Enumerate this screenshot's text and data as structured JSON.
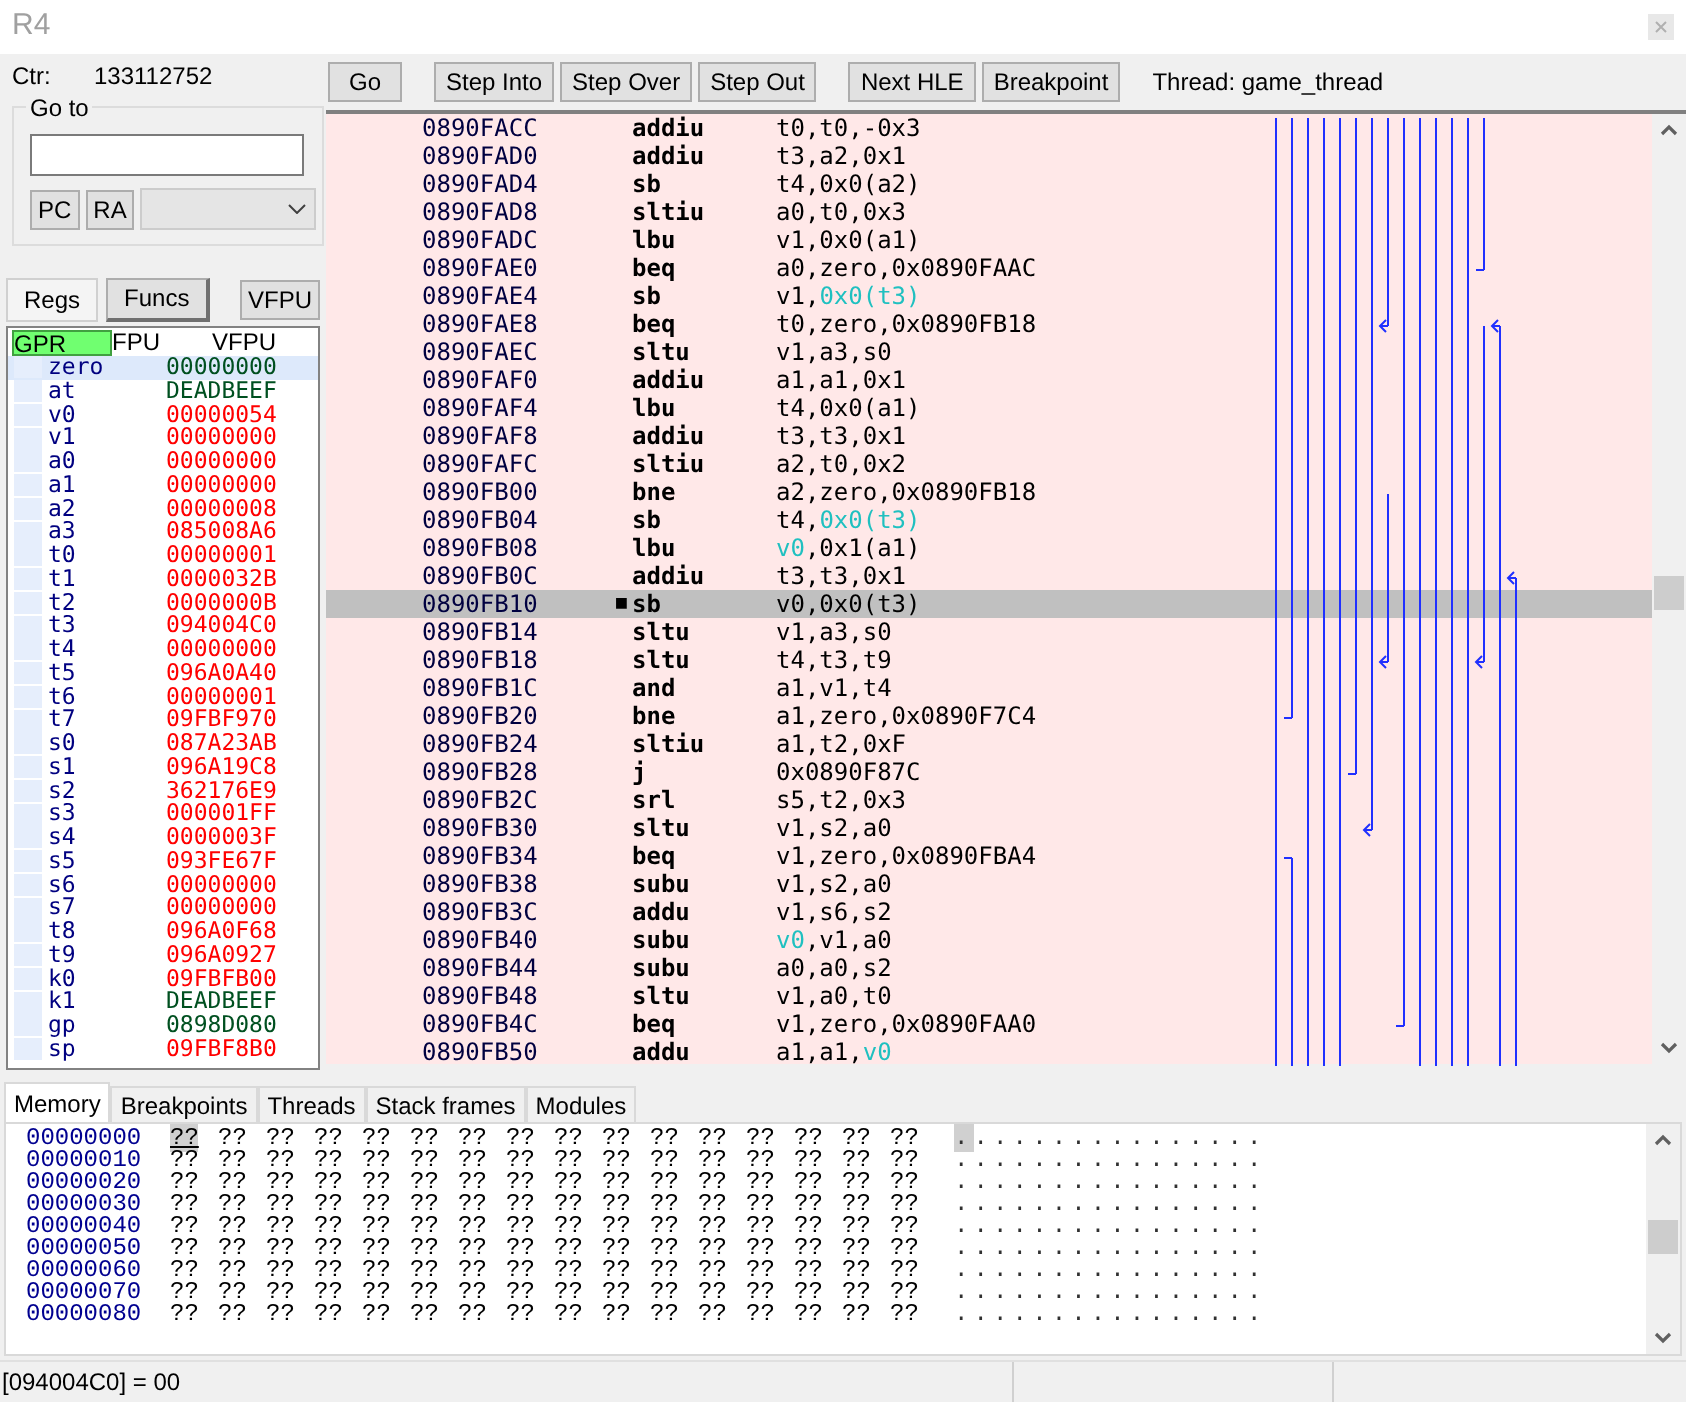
{
  "window": {
    "title": "R4"
  },
  "counter": {
    "label": "Ctr:",
    "value": "133112752"
  },
  "goto": {
    "label": "Go to",
    "buttons": [
      "PC",
      "RA"
    ]
  },
  "left_tabs": [
    {
      "label": "Regs",
      "selected": true
    },
    {
      "label": "Funcs",
      "selected": false
    }
  ],
  "vfpu_button": "VFPU",
  "register_tabs": [
    {
      "label": "GPR",
      "selected": true
    },
    {
      "label": "FPU",
      "selected": false
    },
    {
      "label": "VFPU",
      "selected": false
    }
  ],
  "registers": [
    {
      "name": "zero",
      "value": "00000000",
      "changed": false,
      "selected": true
    },
    {
      "name": "at",
      "value": "DEADBEEF",
      "changed": false,
      "selected": false
    },
    {
      "name": "v0",
      "value": "00000054",
      "changed": true,
      "selected": false
    },
    {
      "name": "v1",
      "value": "00000000",
      "changed": true,
      "selected": false
    },
    {
      "name": "a0",
      "value": "00000000",
      "changed": true,
      "selected": false
    },
    {
      "name": "a1",
      "value": "00000000",
      "changed": true,
      "selected": false
    },
    {
      "name": "a2",
      "value": "00000008",
      "changed": true,
      "selected": false
    },
    {
      "name": "a3",
      "value": "085008A6",
      "changed": true,
      "selected": false
    },
    {
      "name": "t0",
      "value": "00000001",
      "changed": true,
      "selected": false
    },
    {
      "name": "t1",
      "value": "0000032B",
      "changed": true,
      "selected": false
    },
    {
      "name": "t2",
      "value": "0000000B",
      "changed": true,
      "selected": false
    },
    {
      "name": "t3",
      "value": "094004C0",
      "changed": true,
      "selected": false
    },
    {
      "name": "t4",
      "value": "00000000",
      "changed": true,
      "selected": false
    },
    {
      "name": "t5",
      "value": "096A0A40",
      "changed": true,
      "selected": false
    },
    {
      "name": "t6",
      "value": "00000001",
      "changed": true,
      "selected": false
    },
    {
      "name": "t7",
      "value": "09FBF970",
      "changed": true,
      "selected": false
    },
    {
      "name": "s0",
      "value": "087A23AB",
      "changed": true,
      "selected": false
    },
    {
      "name": "s1",
      "value": "096A19C8",
      "changed": true,
      "selected": false
    },
    {
      "name": "s2",
      "value": "362176E9",
      "changed": true,
      "selected": false
    },
    {
      "name": "s3",
      "value": "000001FF",
      "changed": true,
      "selected": false
    },
    {
      "name": "s4",
      "value": "0000003F",
      "changed": true,
      "selected": false
    },
    {
      "name": "s5",
      "value": "093FE67F",
      "changed": true,
      "selected": false
    },
    {
      "name": "s6",
      "value": "00000000",
      "changed": true,
      "selected": false
    },
    {
      "name": "s7",
      "value": "00000000",
      "changed": true,
      "selected": false
    },
    {
      "name": "t8",
      "value": "096A0F68",
      "changed": true,
      "selected": false
    },
    {
      "name": "t9",
      "value": "096A0927",
      "changed": true,
      "selected": false
    },
    {
      "name": "k0",
      "value": "09FBFB00",
      "changed": true,
      "selected": false
    },
    {
      "name": "k1",
      "value": "DEADBEEF",
      "changed": false,
      "selected": false
    },
    {
      "name": "gp",
      "value": "0898D080",
      "changed": false,
      "selected": false
    },
    {
      "name": "sp",
      "value": "09FBF8B0",
      "changed": true,
      "selected": false
    }
  ],
  "toolbar": [
    [
      "Go"
    ],
    [
      "Step Into",
      "Step Over",
      "Step Out"
    ],
    [
      "Next HLE",
      "Breakpoint"
    ]
  ],
  "thread_label": "Thread: game_thread",
  "disassembly": [
    {
      "address": "0890FACC",
      "opcode": "addiu",
      "selected": false,
      "operands": [
        {
          "text": "t0,t0,-0x3",
          "highlighted": false
        }
      ]
    },
    {
      "address": "0890FAD0",
      "opcode": "addiu",
      "selected": false,
      "operands": [
        {
          "text": "t3,a2,0x1",
          "highlighted": false
        }
      ]
    },
    {
      "address": "0890FAD4",
      "opcode": "sb",
      "selected": false,
      "operands": [
        {
          "text": "t4,0x0(a2)",
          "highlighted": false
        }
      ]
    },
    {
      "address": "0890FAD8",
      "opcode": "sltiu",
      "selected": false,
      "operands": [
        {
          "text": "a0,t0,0x3",
          "highlighted": false
        }
      ]
    },
    {
      "address": "0890FADC",
      "opcode": "lbu",
      "selected": false,
      "operands": [
        {
          "text": "v1,0x0(a1)",
          "highlighted": false
        }
      ]
    },
    {
      "address": "0890FAE0",
      "opcode": "beq",
      "selected": false,
      "operands": [
        {
          "text": "a0,zero,0x0890FAAC",
          "highlighted": false
        }
      ]
    },
    {
      "address": "0890FAE4",
      "opcode": "sb",
      "selected": false,
      "operands": [
        {
          "text": "v1,",
          "highlighted": false
        },
        {
          "text": "0x0(t3)",
          "highlighted": true
        }
      ]
    },
    {
      "address": "0890FAE8",
      "opcode": "beq",
      "selected": false,
      "operands": [
        {
          "text": "t0,zero,0x0890FB18",
          "highlighted": false
        }
      ]
    },
    {
      "address": "0890FAEC",
      "opcode": "sltu",
      "selected": false,
      "operands": [
        {
          "text": "v1,a3,s0",
          "highlighted": false
        }
      ]
    },
    {
      "address": "0890FAF0",
      "opcode": "addiu",
      "selected": false,
      "operands": [
        {
          "text": "a1,a1,0x1",
          "highlighted": false
        }
      ]
    },
    {
      "address": "0890FAF4",
      "opcode": "lbu",
      "selected": false,
      "operands": [
        {
          "text": "t4,0x0(a1)",
          "highlighted": false
        }
      ]
    },
    {
      "address": "0890FAF8",
      "opcode": "addiu",
      "selected": false,
      "operands": [
        {
          "text": "t3,t3,0x1",
          "highlighted": false
        }
      ]
    },
    {
      "address": "0890FAFC",
      "opcode": "sltiu",
      "selected": false,
      "operands": [
        {
          "text": "a2,t0,0x2",
          "highlighted": false
        }
      ]
    },
    {
      "address": "0890FB00",
      "opcode": "bne",
      "selected": false,
      "operands": [
        {
          "text": "a2,zero,0x0890FB18",
          "highlighted": false
        }
      ]
    },
    {
      "address": "0890FB04",
      "opcode": "sb",
      "selected": false,
      "operands": [
        {
          "text": "t4,",
          "highlighted": false
        },
        {
          "text": "0x0(t3)",
          "highlighted": true
        }
      ]
    },
    {
      "address": "0890FB08",
      "opcode": "lbu",
      "selected": false,
      "operands": [
        {
          "text": "v0",
          "highlighted": true
        },
        {
          "text": ",0x1(a1)",
          "highlighted": false
        }
      ]
    },
    {
      "address": "0890FB0C",
      "opcode": "addiu",
      "selected": false,
      "operands": [
        {
          "text": "t3,t3,0x1",
          "highlighted": false
        }
      ]
    },
    {
      "address": "0890FB10",
      "marker": "■",
      "opcode": "sb",
      "selected": true,
      "operands": [
        {
          "text": "v0,0x0(t3)",
          "highlighted": false
        }
      ]
    },
    {
      "address": "0890FB14",
      "opcode": "sltu",
      "selected": false,
      "operands": [
        {
          "text": "v1,a3,s0",
          "highlighted": false
        }
      ]
    },
    {
      "address": "0890FB18",
      "opcode": "sltu",
      "selected": false,
      "operands": [
        {
          "text": "t4,t3,t9",
          "highlighted": false
        }
      ]
    },
    {
      "address": "0890FB1C",
      "opcode": "and",
      "selected": false,
      "operands": [
        {
          "text": "a1,v1,t4",
          "highlighted": false
        }
      ]
    },
    {
      "address": "0890FB20",
      "opcode": "bne",
      "selected": false,
      "operands": [
        {
          "text": "a1,zero,0x0890F7C4",
          "highlighted": false
        }
      ]
    },
    {
      "address": "0890FB24",
      "opcode": "sltiu",
      "selected": false,
      "operands": [
        {
          "text": "a1,t2,0xF",
          "highlighted": false
        }
      ]
    },
    {
      "address": "0890FB28",
      "opcode": "j",
      "selected": false,
      "operands": [
        {
          "text": "0x0890F87C",
          "highlighted": false
        }
      ]
    },
    {
      "address": "0890FB2C",
      "opcode": "srl",
      "selected": false,
      "operands": [
        {
          "text": "s5,t2,0x3",
          "highlighted": false
        }
      ]
    },
    {
      "address": "0890FB30",
      "opcode": "sltu",
      "selected": false,
      "operands": [
        {
          "text": "v1,s2,a0",
          "highlighted": false
        }
      ]
    },
    {
      "address": "0890FB34",
      "opcode": "beq",
      "selected": false,
      "operands": [
        {
          "text": "v1,zero,0x0890FBA4",
          "highlighted": false
        }
      ]
    },
    {
      "address": "0890FB38",
      "opcode": "subu",
      "selected": false,
      "operands": [
        {
          "text": "v1,s2,a0",
          "highlighted": false
        }
      ]
    },
    {
      "address": "0890FB3C",
      "opcode": "addu",
      "selected": false,
      "operands": [
        {
          "text": "v1,s6,s2",
          "highlighted": false
        }
      ]
    },
    {
      "address": "0890FB40",
      "opcode": "subu",
      "selected": false,
      "operands": [
        {
          "text": "v0",
          "highlighted": true
        },
        {
          "text": ",v1,a0",
          "highlighted": false
        }
      ]
    },
    {
      "address": "0890FB44",
      "opcode": "subu",
      "selected": false,
      "operands": [
        {
          "text": "a0,a0,s2",
          "highlighted": false
        }
      ]
    },
    {
      "address": "0890FB48",
      "opcode": "sltu",
      "selected": false,
      "operands": [
        {
          "text": "v1,a0,t0",
          "highlighted": false
        }
      ]
    },
    {
      "address": "0890FB4C",
      "opcode": "beq",
      "selected": false,
      "operands": [
        {
          "text": "v1,zero,0x0890FAA0",
          "highlighted": false
        }
      ]
    },
    {
      "address": "0890FB50",
      "opcode": "addu",
      "selected": false,
      "operands": [
        {
          "text": "a1,a1,",
          "highlighted": false
        },
        {
          "text": "v0",
          "highlighted": true
        }
      ]
    }
  ],
  "bottom_tabs": [
    {
      "label": "Memory",
      "selected": true
    },
    {
      "label": "Breakpoints",
      "selected": false
    },
    {
      "label": "Threads",
      "selected": false
    },
    {
      "label": "Stack frames",
      "selected": false
    },
    {
      "label": "Modules",
      "selected": false
    }
  ],
  "memory": [
    {
      "address": "00000000",
      "ascii": "................",
      "bytes": [
        {
          "text": "??",
          "selected": true
        },
        {
          "text": "??",
          "selected": false
        },
        {
          "text": "??",
          "selected": false
        },
        {
          "text": "??",
          "selected": false
        },
        {
          "text": "??",
          "selected": false
        },
        {
          "text": "??",
          "selected": false
        },
        {
          "text": "??",
          "selected": false
        },
        {
          "text": "??",
          "selected": false
        },
        {
          "text": "??",
          "selected": false
        },
        {
          "text": "??",
          "selected": false
        },
        {
          "text": "??",
          "selected": false
        },
        {
          "text": "??",
          "selected": false
        },
        {
          "text": "??",
          "selected": false
        },
        {
          "text": "??",
          "selected": false
        },
        {
          "text": "??",
          "selected": false
        },
        {
          "text": "??",
          "selected": false
        }
      ]
    },
    {
      "address": "00000010",
      "ascii": "................",
      "bytes": [
        {
          "text": "??",
          "selected": false
        },
        {
          "text": "??",
          "selected": false
        },
        {
          "text": "??",
          "selected": false
        },
        {
          "text": "??",
          "selected": false
        },
        {
          "text": "??",
          "selected": false
        },
        {
          "text": "??",
          "selected": false
        },
        {
          "text": "??",
          "selected": false
        },
        {
          "text": "??",
          "selected": false
        },
        {
          "text": "??",
          "selected": false
        },
        {
          "text": "??",
          "selected": false
        },
        {
          "text": "??",
          "selected": false
        },
        {
          "text": "??",
          "selected": false
        },
        {
          "text": "??",
          "selected": false
        },
        {
          "text": "??",
          "selected": false
        },
        {
          "text": "??",
          "selected": false
        },
        {
          "text": "??",
          "selected": false
        }
      ]
    },
    {
      "address": "00000020",
      "ascii": "................",
      "bytes": [
        {
          "text": "??",
          "selected": false
        },
        {
          "text": "??",
          "selected": false
        },
        {
          "text": "??",
          "selected": false
        },
        {
          "text": "??",
          "selected": false
        },
        {
          "text": "??",
          "selected": false
        },
        {
          "text": "??",
          "selected": false
        },
        {
          "text": "??",
          "selected": false
        },
        {
          "text": "??",
          "selected": false
        },
        {
          "text": "??",
          "selected": false
        },
        {
          "text": "??",
          "selected": false
        },
        {
          "text": "??",
          "selected": false
        },
        {
          "text": "??",
          "selected": false
        },
        {
          "text": "??",
          "selected": false
        },
        {
          "text": "??",
          "selected": false
        },
        {
          "text": "??",
          "selected": false
        },
        {
          "text": "??",
          "selected": false
        }
      ]
    },
    {
      "address": "00000030",
      "ascii": "................",
      "bytes": [
        {
          "text": "??",
          "selected": false
        },
        {
          "text": "??",
          "selected": false
        },
        {
          "text": "??",
          "selected": false
        },
        {
          "text": "??",
          "selected": false
        },
        {
          "text": "??",
          "selected": false
        },
        {
          "text": "??",
          "selected": false
        },
        {
          "text": "??",
          "selected": false
        },
        {
          "text": "??",
          "selected": false
        },
        {
          "text": "??",
          "selected": false
        },
        {
          "text": "??",
          "selected": false
        },
        {
          "text": "??",
          "selected": false
        },
        {
          "text": "??",
          "selected": false
        },
        {
          "text": "??",
          "selected": false
        },
        {
          "text": "??",
          "selected": false
        },
        {
          "text": "??",
          "selected": false
        },
        {
          "text": "??",
          "selected": false
        }
      ]
    },
    {
      "address": "00000040",
      "ascii": "................",
      "bytes": [
        {
          "text": "??",
          "selected": false
        },
        {
          "text": "??",
          "selected": false
        },
        {
          "text": "??",
          "selected": false
        },
        {
          "text": "??",
          "selected": false
        },
        {
          "text": "??",
          "selected": false
        },
        {
          "text": "??",
          "selected": false
        },
        {
          "text": "??",
          "selected": false
        },
        {
          "text": "??",
          "selected": false
        },
        {
          "text": "??",
          "selected": false
        },
        {
          "text": "??",
          "selected": false
        },
        {
          "text": "??",
          "selected": false
        },
        {
          "text": "??",
          "selected": false
        },
        {
          "text": "??",
          "selected": false
        },
        {
          "text": "??",
          "selected": false
        },
        {
          "text": "??",
          "selected": false
        },
        {
          "text": "??",
          "selected": false
        }
      ]
    },
    {
      "address": "00000050",
      "ascii": "................",
      "bytes": [
        {
          "text": "??",
          "selected": false
        },
        {
          "text": "??",
          "selected": false
        },
        {
          "text": "??",
          "selected": false
        },
        {
          "text": "??",
          "selected": false
        },
        {
          "text": "??",
          "selected": false
        },
        {
          "text": "??",
          "selected": false
        },
        {
          "text": "??",
          "selected": false
        },
        {
          "text": "??",
          "selected": false
        },
        {
          "text": "??",
          "selected": false
        },
        {
          "text": "??",
          "selected": false
        },
        {
          "text": "??",
          "selected": false
        },
        {
          "text": "??",
          "selected": false
        },
        {
          "text": "??",
          "selected": false
        },
        {
          "text": "??",
          "selected": false
        },
        {
          "text": "??",
          "selected": false
        },
        {
          "text": "??",
          "selected": false
        }
      ]
    },
    {
      "address": "00000060",
      "ascii": "................",
      "bytes": [
        {
          "text": "??",
          "selected": false
        },
        {
          "text": "??",
          "selected": false
        },
        {
          "text": "??",
          "selected": false
        },
        {
          "text": "??",
          "selected": false
        },
        {
          "text": "??",
          "selected": false
        },
        {
          "text": "??",
          "selected": false
        },
        {
          "text": "??",
          "selected": false
        },
        {
          "text": "??",
          "selected": false
        },
        {
          "text": "??",
          "selected": false
        },
        {
          "text": "??",
          "selected": false
        },
        {
          "text": "??",
          "selected": false
        },
        {
          "text": "??",
          "selected": false
        },
        {
          "text": "??",
          "selected": false
        },
        {
          "text": "??",
          "selected": false
        },
        {
          "text": "??",
          "selected": false
        },
        {
          "text": "??",
          "selected": false
        }
      ]
    },
    {
      "address": "00000070",
      "ascii": "................",
      "bytes": [
        {
          "text": "??",
          "selected": false
        },
        {
          "text": "??",
          "selected": false
        },
        {
          "text": "??",
          "selected": false
        },
        {
          "text": "??",
          "selected": false
        },
        {
          "text": "??",
          "selected": false
        },
        {
          "text": "??",
          "selected": false
        },
        {
          "text": "??",
          "selected": false
        },
        {
          "text": "??",
          "selected": false
        },
        {
          "text": "??",
          "selected": false
        },
        {
          "text": "??",
          "selected": false
        },
        {
          "text": "??",
          "selected": false
        },
        {
          "text": "??",
          "selected": false
        },
        {
          "text": "??",
          "selected": false
        },
        {
          "text": "??",
          "selected": false
        },
        {
          "text": "??",
          "selected": false
        },
        {
          "text": "??",
          "selected": false
        }
      ]
    },
    {
      "address": "00000080",
      "ascii": "................",
      "bytes": [
        {
          "text": "??",
          "selected": false
        },
        {
          "text": "??",
          "selected": false
        },
        {
          "text": "??",
          "selected": false
        },
        {
          "text": "??",
          "selected": false
        },
        {
          "text": "??",
          "selected": false
        },
        {
          "text": "??",
          "selected": false
        },
        {
          "text": "??",
          "selected": false
        },
        {
          "text": "??",
          "selected": false
        },
        {
          "text": "??",
          "selected": false
        },
        {
          "text": "??",
          "selected": false
        },
        {
          "text": "??",
          "selected": false
        },
        {
          "text": "??",
          "selected": false
        },
        {
          "text": "??",
          "selected": false
        },
        {
          "text": "??",
          "selected": false
        },
        {
          "text": "??",
          "selected": false
        },
        {
          "text": "??",
          "selected": false
        }
      ]
    }
  ],
  "status_bar": {
    "text": "[094004C0] = 00"
  }
}
